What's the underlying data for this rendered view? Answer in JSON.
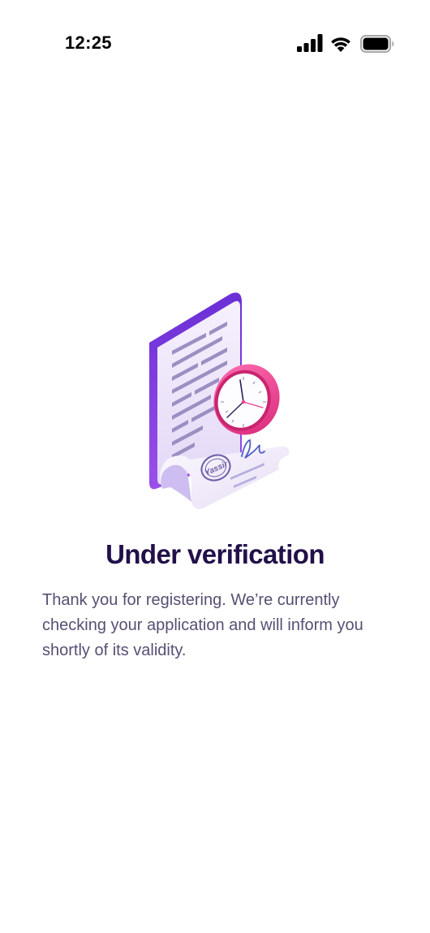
{
  "status_bar": {
    "time": "12:25",
    "icons": [
      "cellular-signal-icon",
      "wifi-icon",
      "battery-icon"
    ]
  },
  "illustration": {
    "name": "document-clock-illustration",
    "stamp_text": "Yassir"
  },
  "content": {
    "title": "Under verification",
    "description": "Thank you for registering. We’re currently checking your application and will inform you shortly of its validity."
  },
  "colors": {
    "title": "#22104a",
    "body_text": "#574f73",
    "document_purple": "#7b3fe0",
    "clock_pink": "#ec3f8f",
    "background": "#ffffff"
  }
}
